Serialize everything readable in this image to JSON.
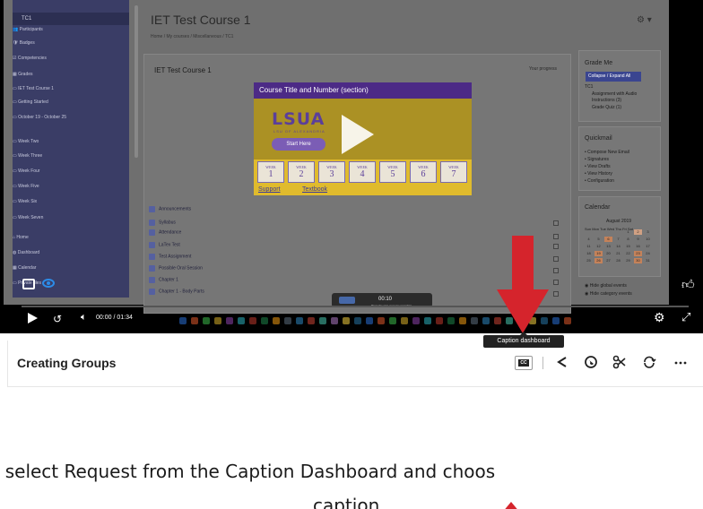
{
  "screen": {
    "sidebar": {
      "header": "TC1",
      "items": [
        "Participants",
        "Badges",
        "Competencies",
        "Grades",
        "IET Test Course 1",
        "Getting Started",
        "October 19 - October 25",
        "Week Two",
        "Week Three",
        "Week Four",
        "Week Five",
        "Week Six",
        "Week Seven",
        "Home",
        "Dashboard",
        "Calendar",
        "Private files"
      ]
    },
    "page_title": "IET Test Course 1",
    "breadcrumb": "Home / My courses / Miscellaneous / TC1",
    "course_name": "IET Test Course 1",
    "your_progress": "Your progress",
    "banner": {
      "title": "Course Title and Number (section)",
      "logo": "LSUA",
      "logo_sub": "LSU OF ALEXANDRIA",
      "start": "Start Here",
      "week_label": "WEEK",
      "weeks": [
        "1",
        "2",
        "3",
        "4",
        "5",
        "6",
        "7"
      ],
      "links": [
        "Support",
        "Textbook"
      ]
    },
    "activities": [
      "Announcements",
      "Syllabus",
      "Attendance",
      "LaTex Test",
      "Test Assignment",
      "Possible Oral Session",
      "Chapter 1",
      "Chapter 1 - Body Parts"
    ],
    "grade_me": {
      "title": "Grade Me",
      "button": "Collapse / Expand All",
      "lines": [
        "TC1",
        "Assignment with Audio Instructions (3)",
        "Grade Quiz (1)"
      ]
    },
    "quickmail": {
      "title": "Quickmail",
      "items": [
        "Compose New Email",
        "Signatures",
        "View Drafts",
        "View History",
        "Configuration"
      ]
    },
    "calendar": {
      "title": "Calendar",
      "month": "August 2019",
      "days": "Sun Mon Tue Wed Thu Fri Sat"
    },
    "legend": [
      "Hide global events",
      "Hide category events"
    ],
    "recorder": {
      "time": "00:10",
      "subtext": "Press the stop or pause recording"
    }
  },
  "player": {
    "time_display": "00:00 / 01:34",
    "progress": 0.0,
    "tooltip": "Caption dashboard"
  },
  "info_bar": {
    "title": "Creating Groups",
    "cc_label": "CC"
  },
  "caption_text": {
    "line1": ", select Request from the Caption Dashboard and choos",
    "line2": "caption"
  },
  "colors": {
    "arrow": "#d5242c",
    "sidebar": "#3a3d66",
    "banner_purple": "#4c2a86",
    "banner_gold": "#c9a227",
    "eye_blue": "#2c8ce8"
  },
  "icons": {
    "cc_overlay": "caption-icon",
    "eye": "eye-icon",
    "like": "thumbs-up-icon",
    "play": "play-icon",
    "rewind": "rewind-10-icon",
    "volume": "volume-icon",
    "settings": "gear-icon",
    "fullscreen": "fullscreen-icon",
    "share": "share-icon",
    "globe": "globe-icon",
    "clip": "scissors-icon",
    "embed": "refresh-icon",
    "more": "more-icon"
  }
}
